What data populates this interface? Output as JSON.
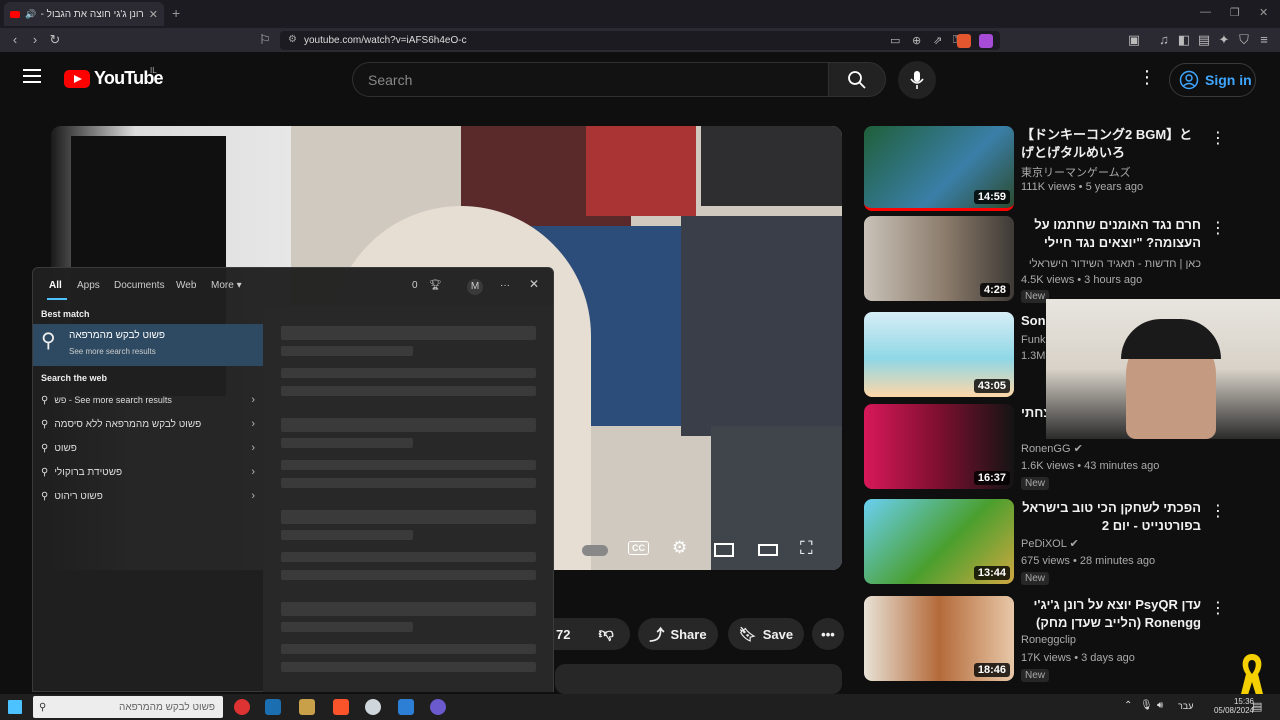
{
  "browser": {
    "tab_title": "רונן ג'גי חוצה את הגבול - YouTube",
    "url": "youtube.com/watch?v=iAFS6h4eO-c",
    "new_tab": "+"
  },
  "header": {
    "logo_text": "YouTube",
    "country": "IL",
    "search_placeholder": "Search",
    "signin_label": "Sign in"
  },
  "player": {
    "actions": {
      "likes": "72",
      "share_label": "Share",
      "save_label": "Save"
    }
  },
  "recommendations": [
    {
      "title": "【ドンキーコング2 BGM】とげとげタルめいろ",
      "channel": "東京リーマンゲームズ",
      "meta": "111K views • 5 years ago",
      "duration": "14:59",
      "badge": "",
      "rtl": false
    },
    {
      "title": "חרם נגד האומנים שחתמו על העצומה? \"יוצאים נגד חיילי צה\"ל, לא...",
      "channel": "כאן | חדשות - תאגיד השידור הישראלי",
      "meta": "4.5K views • 3 hours ago",
      "duration": "4:28",
      "badge": "New",
      "rtl": true
    },
    {
      "title": "Soni",
      "channel": "Funk",
      "meta": "1.3M",
      "duration": "43:05",
      "badge": "",
      "rtl": false
    },
    {
      "title": "ניצחתי!",
      "channel": "RonenGG",
      "meta": "1.6K views • 43 minutes ago",
      "duration": "16:37",
      "badge": "New",
      "rtl": false
    },
    {
      "title": "הפכתי לשחקן הכי טוב בישראל בפורטנייט - יום 2",
      "channel": "PeDiXOL",
      "meta": "675 views • 28 minutes ago",
      "duration": "13:44",
      "badge": "New",
      "rtl": true
    },
    {
      "title": "עדן PsyQR יוצא על רונן ג'יג'י Ronengg (הלייב שעדן מחק)",
      "channel": "Roneggclip",
      "meta": "17K views • 3 days ago",
      "duration": "18:46",
      "badge": "New",
      "rtl": true
    }
  ],
  "windows_search": {
    "tabs": [
      "All",
      "Apps",
      "Documents",
      "Web",
      "More"
    ],
    "count": "0",
    "avatar": "M",
    "best_match_label": "Best match",
    "best_match_title": "פשוט לבקש מהמרפאה",
    "best_match_sub": "See more search results",
    "web_label": "Search the web",
    "web_items": [
      "פש - See more search results",
      "פשוט לבקש מהמרפאה ללא סיסמה",
      "פשוט",
      "פשטידת ברוקולי",
      "פשוט ריהוט"
    ]
  },
  "taskbar": {
    "search_text": "פשוט לבקש מהמרפאה",
    "time": "15:36",
    "date": "05/08/2024",
    "lang": "עבר"
  }
}
